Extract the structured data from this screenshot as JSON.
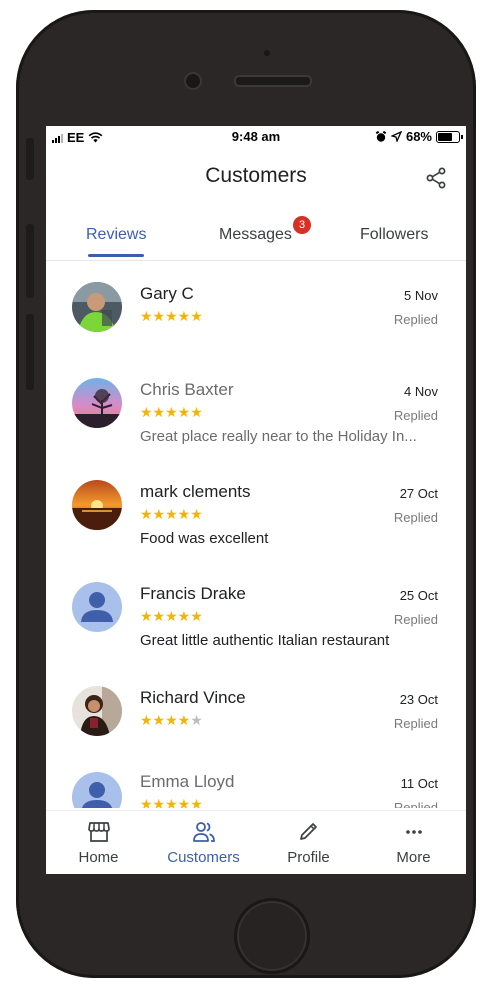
{
  "status_bar": {
    "carrier": "EE",
    "time": "9:48 am",
    "battery": "68%"
  },
  "app_bar": {
    "title": "Customers",
    "share_icon": "share-icon"
  },
  "tabs": [
    {
      "label": "Reviews",
      "active": true
    },
    {
      "label": "Messages",
      "badge": "3"
    },
    {
      "label": "Followers"
    }
  ],
  "reviews": [
    {
      "name": "Gary C",
      "rating": 5,
      "stars": "★★★★★",
      "date": "5 Nov",
      "status": "Replied",
      "text": ""
    },
    {
      "name": "Chris Baxter",
      "rating": 5,
      "stars": "★★★★★",
      "date": "4 Nov",
      "status": "Replied",
      "text": "Great place really near to the Holiday In..."
    },
    {
      "name": "mark clements",
      "rating": 5,
      "stars": "★★★★★",
      "date": "27 Oct",
      "status": "Replied",
      "text": "Food was excellent"
    },
    {
      "name": "Francis Drake",
      "rating": 5,
      "stars": "★★★★★",
      "date": "25 Oct",
      "status": "Replied",
      "text": "Great little authentic Italian restaurant"
    },
    {
      "name": "Richard Vince",
      "rating": 4,
      "stars_on": "★★★★",
      "stars_off": "★",
      "date": "23 Oct",
      "status": "Replied",
      "text": ""
    },
    {
      "name": "Emma Lloyd",
      "rating": 5,
      "stars": "★★★★★",
      "date": "11 Oct",
      "status": "Replied",
      "text": ""
    }
  ],
  "bottom_nav": [
    {
      "label": "Home",
      "icon": "storefront-icon"
    },
    {
      "label": "Customers",
      "icon": "people-icon",
      "active": true
    },
    {
      "label": "Profile",
      "icon": "pencil-icon"
    },
    {
      "label": "More",
      "icon": "more-horizontal-icon"
    }
  ],
  "colors": {
    "accent": "#3b5fad",
    "star": "#f4b400",
    "badge": "#d93025",
    "phone_body": "#2a2726"
  }
}
